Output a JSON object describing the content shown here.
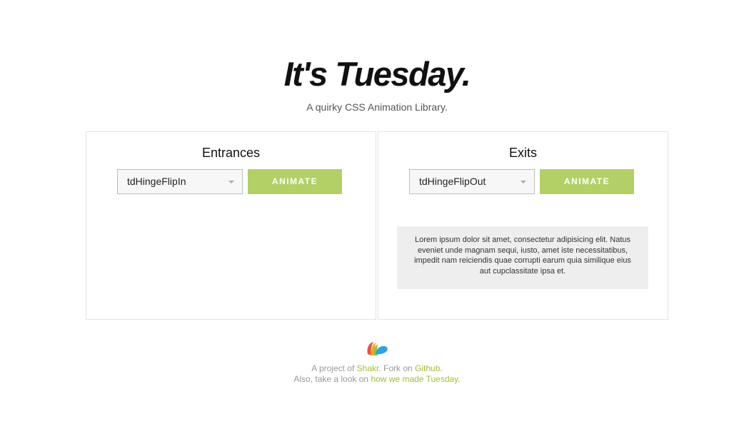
{
  "header": {
    "title": "It's Tuesday.",
    "subtitle": "A quirky CSS Animation Library."
  },
  "entrances": {
    "title": "Entrances",
    "selected_animation": "tdHingeFlipIn",
    "button_label": "ANIMATE"
  },
  "exits": {
    "title": "Exits",
    "selected_animation": "tdHingeFlipOut",
    "button_label": "ANIMATE",
    "sample_text": "Lorem ipsum dolor sit amet, consectetur adipisicing elit. Natus eveniet unde magnam sequi, iusto, amet iste necessitatibus, impedit nam reiciendis quae corrupti earum quia similique eius aut cupclassitate ipsa et."
  },
  "footer": {
    "line1_prefix": "A project of ",
    "shakr_link": "Shakr",
    "line1_middle": ". Fork on ",
    "github_link": "Github",
    "line1_suffix": ".",
    "line2_prefix": "Also, take a look on ",
    "made_link": "how we made Tuesday",
    "line2_suffix": "."
  },
  "icons": {
    "logo": "shakr-logo-icon",
    "select_caret": "chevron-down-icon"
  },
  "colors": {
    "accent_green": "#b2d066",
    "link_green": "#9dbf3a",
    "panel_border": "#e3e3e3",
    "sample_bg": "#eeeeee"
  }
}
